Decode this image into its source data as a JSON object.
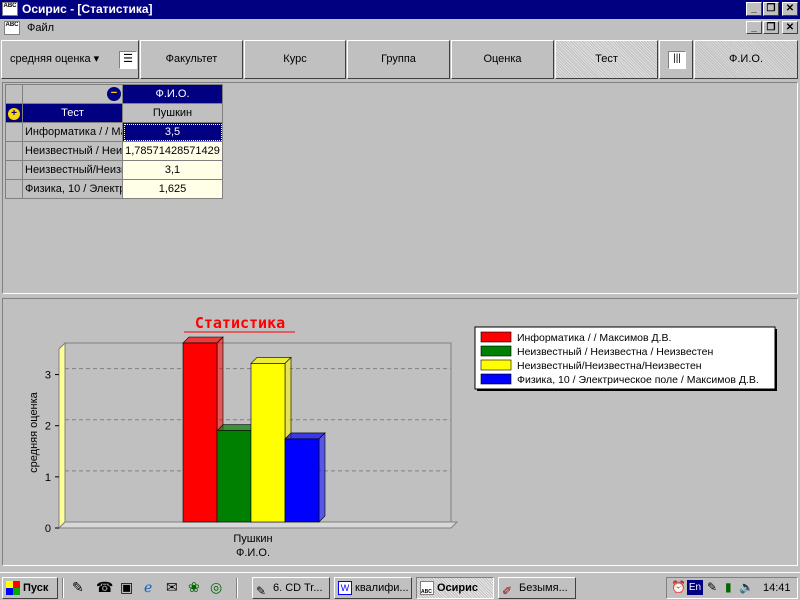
{
  "window": {
    "title": "Осирис - [Статистика]",
    "app_icon_text": "ABC"
  },
  "menu": {
    "items": [
      "Файл"
    ]
  },
  "toolbar": {
    "data_field": "средняя оценка",
    "fields": [
      "Факультет",
      "Курс",
      "Группа",
      "Оценка",
      "Тест",
      "Ф.И.О."
    ]
  },
  "pivot": {
    "column_field": "Ф.И.О.",
    "row_field": "Тест",
    "column_value": "Пушкин",
    "rows": [
      {
        "label": "Информатика /  / Максимов Д.В.",
        "value": "3,5"
      },
      {
        "label": "Неизвестный / Неизвестна / Неизвестен",
        "value": "1,78571428571429"
      },
      {
        "label": "Неизвестный/Неизвестна/Неизвестен",
        "value": "3,1"
      },
      {
        "label": "Физика, 10 / Электрическое поле / Максимов Д.В.",
        "value": "1,625"
      }
    ]
  },
  "chart_data": {
    "type": "bar",
    "title": "Статистика",
    "categories": [
      "Пушкин"
    ],
    "category_axis_title": "Ф.И.О.",
    "ylabel": "средняя оценка",
    "ylim": [
      0,
      3.5
    ],
    "yticks": [
      0,
      1,
      2,
      3
    ],
    "grid": true,
    "legend_position": "top-right",
    "series": [
      {
        "name": "Информатика /  / Максимов Д.В.",
        "values": [
          3.5
        ],
        "color": "#ff0000"
      },
      {
        "name": "Неизвестный / Неизвестна / Неизвестен",
        "values": [
          1.78571428571429
        ],
        "color": "#008000"
      },
      {
        "name": "Неизвестный/Неизвестна/Неизвестен",
        "values": [
          3.1
        ],
        "color": "#ffff00"
      },
      {
        "name": "Физика, 10 / Электрическое поле / Максимов Д.В.",
        "values": [
          1.625
        ],
        "color": "#0000ff"
      }
    ]
  },
  "taskbar": {
    "start_label": "Пуск",
    "tasks": [
      "6. CD Tr...",
      "квалифи...",
      "Осирис",
      "Безымя..."
    ],
    "active_task": "Осирис",
    "lang": "En",
    "clock": "14:41"
  },
  "colors": {
    "title_bar": "#000080",
    "selection": "#000080",
    "cell_bg": "#ffffe8",
    "title_text": "#ff0000"
  }
}
